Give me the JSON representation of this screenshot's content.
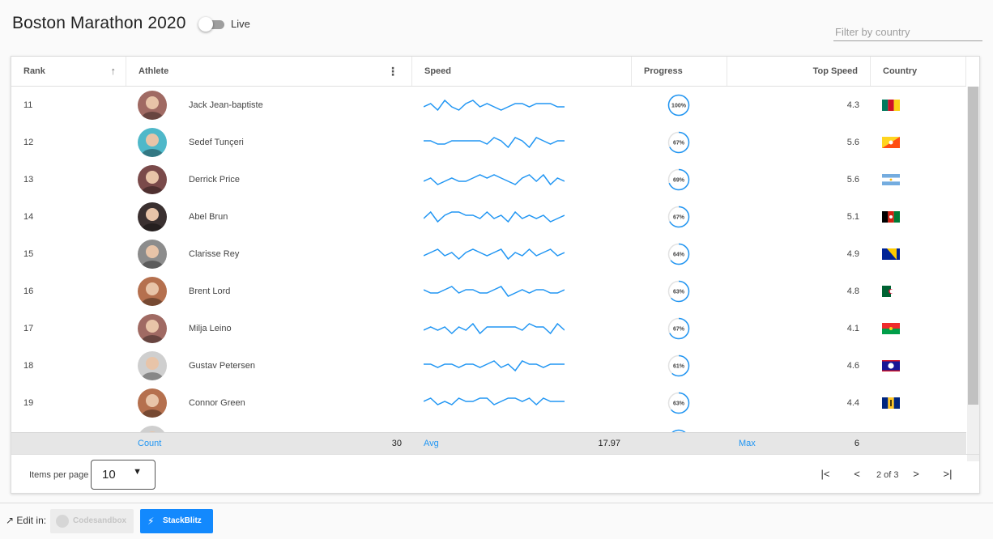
{
  "title": "Boston Marathon 2020",
  "live_toggle": {
    "label": "Live",
    "on": false
  },
  "filter": {
    "placeholder": "Filter by country",
    "value": ""
  },
  "columns": {
    "rank": "Rank",
    "athlete": "Athlete",
    "speed": "Speed",
    "progress": "Progress",
    "top_speed": "Top Speed",
    "country": "Country"
  },
  "rows": [
    {
      "rank": "11",
      "name": "Jack Jean-baptiste",
      "progress": 100,
      "progress_label": "100%",
      "top_speed": "4.3",
      "avatar": "#a06a63",
      "flag": "cameroon",
      "speed": [
        4,
        5,
        3,
        6,
        4,
        3,
        5,
        6,
        4,
        5,
        4,
        3,
        4,
        5,
        5,
        4,
        5,
        5,
        5,
        4,
        4
      ]
    },
    {
      "rank": "12",
      "name": "Sedef Tunçeri",
      "progress": 67,
      "progress_label": "67%",
      "top_speed": "5.6",
      "avatar": "#4fb8c9",
      "flag": "bhutan",
      "speed": [
        5,
        5,
        4,
        4,
        5,
        5,
        5,
        5,
        5,
        4,
        6,
        5,
        3,
        6,
        5,
        3,
        6,
        5,
        4,
        5,
        5
      ]
    },
    {
      "rank": "13",
      "name": "Derrick Price",
      "progress": 69,
      "progress_label": "69%",
      "top_speed": "5.6",
      "avatar": "#7a4a4a",
      "flag": "argentina",
      "speed": [
        4,
        5,
        3,
        4,
        5,
        4,
        4,
        5,
        6,
        5,
        6,
        5,
        4,
        3,
        5,
        6,
        4,
        6,
        3,
        5,
        4
      ]
    },
    {
      "rank": "14",
      "name": "Abel Brun",
      "progress": 67,
      "progress_label": "67%",
      "top_speed": "5.1",
      "avatar": "#3a3030",
      "flag": "afghanistan",
      "speed": [
        4,
        6,
        3,
        5,
        6,
        6,
        5,
        5,
        4,
        6,
        4,
        5,
        3,
        6,
        4,
        5,
        4,
        5,
        3,
        4,
        5
      ]
    },
    {
      "rank": "15",
      "name": "Clarisse Rey",
      "progress": 64,
      "progress_label": "64%",
      "top_speed": "4.9",
      "avatar": "#8c8c8c",
      "flag": "bosnia",
      "speed": [
        4,
        5,
        6,
        4,
        5,
        3,
        5,
        6,
        5,
        4,
        5,
        6,
        3,
        5,
        4,
        6,
        4,
        5,
        6,
        4,
        5
      ]
    },
    {
      "rank": "16",
      "name": "Brent Lord",
      "progress": 63,
      "progress_label": "63%",
      "top_speed": "4.8",
      "avatar": "#b5704e",
      "flag": "algeria",
      "speed": [
        5,
        4,
        4,
        5,
        6,
        4,
        5,
        5,
        4,
        4,
        5,
        6,
        3,
        4,
        5,
        4,
        5,
        5,
        4,
        4,
        5
      ]
    },
    {
      "rank": "17",
      "name": "Milja Leino",
      "progress": 67,
      "progress_label": "67%",
      "top_speed": "4.1",
      "avatar": "#a06a63",
      "flag": "burkina_faso",
      "speed": [
        4,
        5,
        4,
        5,
        3,
        5,
        4,
        6,
        3,
        5,
        5,
        5,
        5,
        5,
        4,
        6,
        5,
        5,
        3,
        6,
        4
      ]
    },
    {
      "rank": "18",
      "name": "Gustav Petersen",
      "progress": 61,
      "progress_label": "61%",
      "top_speed": "4.6",
      "avatar": "#cfcfcf",
      "flag": "belize",
      "speed": [
        5,
        5,
        4,
        5,
        5,
        4,
        5,
        5,
        4,
        5,
        6,
        4,
        5,
        3,
        6,
        5,
        5,
        4,
        5,
        5,
        5
      ]
    },
    {
      "rank": "19",
      "name": "Connor Green",
      "progress": 63,
      "progress_label": "63%",
      "top_speed": "4.4",
      "avatar": "#b5704e",
      "flag": "barbados",
      "speed": [
        5,
        6,
        4,
        5,
        4,
        6,
        5,
        5,
        6,
        6,
        4,
        5,
        6,
        6,
        5,
        6,
        4,
        6,
        5,
        5,
        5
      ]
    }
  ],
  "footer": {
    "count_label": "Count",
    "count_value": "30",
    "avg_label": "Avg",
    "avg_value": "17.97",
    "max_label": "Max",
    "max_value": "6"
  },
  "pager": {
    "items_per_page_label": "Items per page",
    "items_per_page_value": "10",
    "page_info": "2 of 3"
  },
  "edit_in": {
    "label": "Edit in:",
    "codesandbox": "Codesandbox",
    "stackblitz": "StackBlitz"
  },
  "colors": {
    "accent": "#2196f3",
    "sparkline": "#2196f3"
  }
}
